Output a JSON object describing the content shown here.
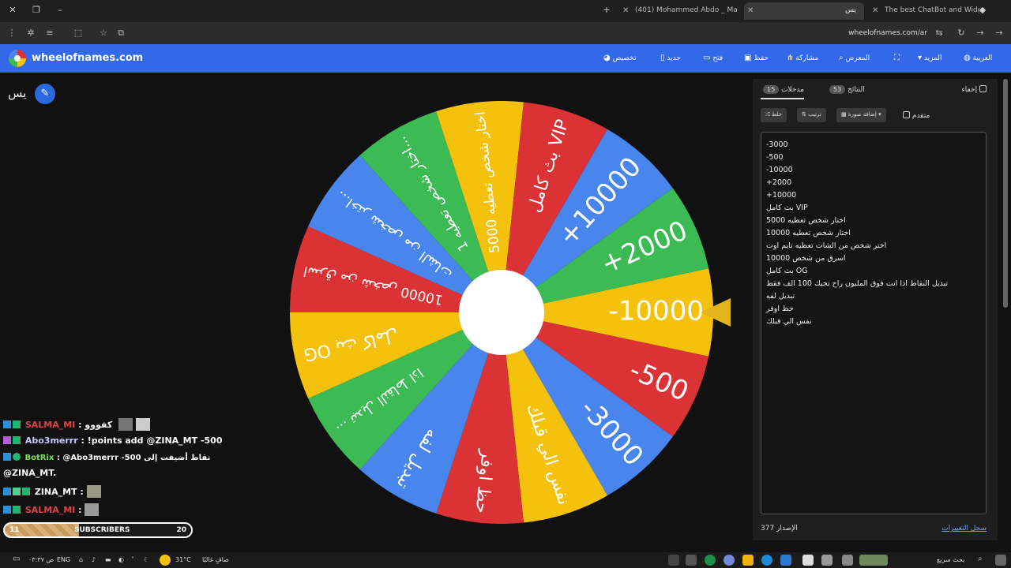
{
  "browser": {
    "tabs": [
      {
        "label": "The best ChatBot and Widgets",
        "active": false
      },
      {
        "label": "يس",
        "active": true
      },
      {
        "label": "(401) Mohammed Abdo _ Ma",
        "active": false
      }
    ],
    "url": "wheelofnames.com/ar"
  },
  "app": {
    "site_name": "wheelofnames.com",
    "menu": {
      "language": "العربية",
      "more": "المزيد",
      "gallery": "المعرض",
      "share": "مشاركة",
      "save": "حفظ",
      "open": "فتح",
      "new": "جديد",
      "customize": "تخصيص"
    }
  },
  "wheel": {
    "title": "يس",
    "slices": [
      {
        "label": "-10000",
        "color": "#f4c20d"
      },
      {
        "label": "-500",
        "color": "#db3236"
      },
      {
        "label": "-3000",
        "color": "#4885ed"
      },
      {
        "label": "نفس الي قبلك",
        "color": "#f4c20d"
      },
      {
        "label": "حظ اوفر",
        "color": "#db3236"
      },
      {
        "label": "تبديل لفه",
        "color": "#4885ed"
      },
      {
        "label": "تبديل النقاط اذا انت فوق المليون راح تجيك 100 الف فقط",
        "color": "#3cba54"
      },
      {
        "label": "بث كامل OG",
        "color": "#f4c20d"
      },
      {
        "label": "اسرق من شخص 10000",
        "color": "#db3236"
      },
      {
        "label": "اختر شخص من الشات تعطيه تايم اوت",
        "color": "#4885ed"
      },
      {
        "label": "اختار شخص تعطيه 10000",
        "color": "#3cba54"
      },
      {
        "label": "اختار شخص تعطيه 5000",
        "color": "#f4c20d"
      },
      {
        "label": "بث كامل VIP",
        "color": "#db3236"
      },
      {
        "label": "+10000",
        "color": "#4885ed"
      },
      {
        "label": "+2000",
        "color": "#3cba54"
      }
    ]
  },
  "chat": [
    {
      "user": "SALMA_MI",
      "user_color": "#e04040",
      "text": "كفووو"
    },
    {
      "user": "Abo3merrr",
      "user_color": "#c8c8ff",
      "text": "!points add @ZINA_MT -500"
    },
    {
      "user": "BotRix",
      "user_color": "#7ddc5b",
      "text": "@Abo3merrr -500 نقاط أضيفت إلى"
    },
    {
      "user": "",
      "user_color": "#ffffff",
      "text": "@ZINA_MT."
    },
    {
      "user": "ZINA_MT",
      "user_color": "#ffffff",
      "text": ""
    },
    {
      "user": "SALMA_MI",
      "user_color": "#e04040",
      "text": ""
    }
  ],
  "subscribers": {
    "label": "SUBSCRIBERS",
    "current": "11",
    "goal": "20",
    "progress": 0.4
  },
  "panel": {
    "hide_label": "إخفاء",
    "tab_entries": "مدخلات",
    "entries_count": "15",
    "tab_results": "النتائج",
    "results_count": "53",
    "shuffle": "خلط",
    "sort": "ترتيب",
    "add_image": "إضافة صورة",
    "advanced": "متقدم",
    "entries": [
      "-3000",
      "-500",
      "-10000",
      "+2000",
      "+10000",
      "بث كامل VIP",
      "اختار شخص تعطيه 5000",
      "اختار شخص تعطيه 10000",
      "اختر شخص من الشات تعطيه تايم اوت",
      "اسرق من شخص 10000",
      "بث كامل OG",
      "تبديل النقاط اذا انت فوق المليون راح تجيك 100 الف فقط",
      "تبديل لفه",
      "حظ اوفر",
      "نفس الي قبلك"
    ],
    "version_label": "الإصدار",
    "version": "377",
    "changelog": "سجل التغييرات"
  },
  "taskbar": {
    "search": "بحث سريع",
    "weather_temp": "31°C",
    "weather_text": "صافٍ غالبًا",
    "lang": "ENG",
    "time": "۰۳:۳۷ ص"
  },
  "colors": {
    "accent": "#3369e8",
    "pointer": "#e3b51a"
  }
}
